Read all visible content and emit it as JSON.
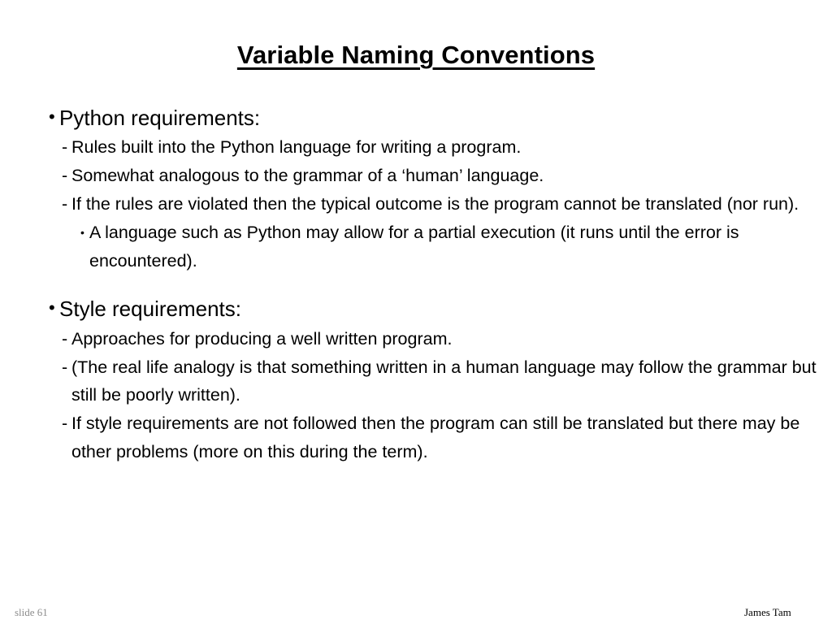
{
  "slide": {
    "title": "Variable Naming Conventions",
    "sections": [
      {
        "heading": "Python requirements:",
        "bullet_glyph": "•",
        "items": [
          {
            "level": 2,
            "glyph": "-",
            "text": "Rules built into the Python language for writing a program."
          },
          {
            "level": 2,
            "glyph": "-",
            "text": "Somewhat analogous to the grammar of a ‘human’ language."
          },
          {
            "level": 2,
            "glyph": "-",
            "text": "If the rules are violated then the typical outcome is the program cannot be translated (nor run)."
          },
          {
            "level": 3,
            "glyph": "•",
            "text": "A language such as Python may allow for a partial execution (it runs until the error is encountered)."
          }
        ]
      },
      {
        "heading": "Style requirements:",
        "bullet_glyph": "•",
        "items": [
          {
            "level": 2,
            "glyph": "-",
            "text": "Approaches for producing a well written program."
          },
          {
            "level": 2,
            "glyph": "-",
            "text": "(The real life analogy is that something written in a human language may follow the grammar but still be poorly written)."
          },
          {
            "level": 2,
            "glyph": "-",
            "text": "If style requirements are not followed then the program can still be translated but there may be other problems (more on this during the term)."
          }
        ]
      }
    ],
    "footer": {
      "slide_number": "slide 61",
      "author": "James Tam"
    },
    "colors": {
      "background": "#ffffff",
      "text": "#000000",
      "slide_number": "#8c8c8c"
    }
  }
}
